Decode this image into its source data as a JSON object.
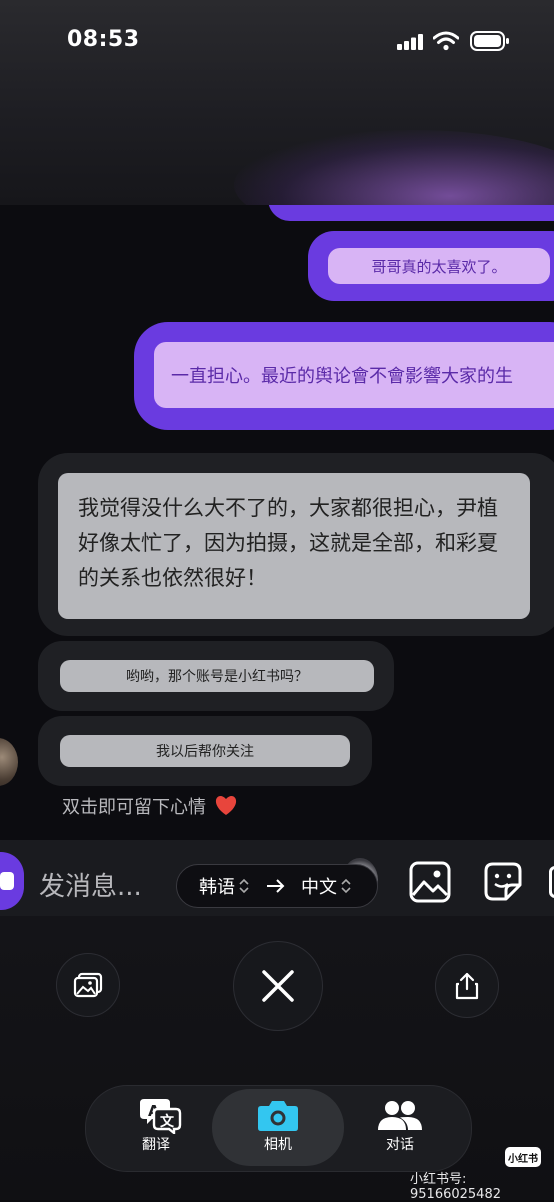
{
  "status_bar": {
    "time": "08:53"
  },
  "messages": {
    "sent_1": "哥哥真的太喜欢了。",
    "sent_2": "一直担心。最近的舆论會不會影響大家的生",
    "recv_1": "我觉得没什么大不了的，大家都很担心，尹植好像太忙了，因为拍摄，这就是全部，和彩夏的关系也依然很好！",
    "recv_2": "哟哟，那个账号是小红书吗？",
    "recv_3": "我以后帮你关注"
  },
  "hint": "双击即可留下心情",
  "input": {
    "placeholder": "发消息..."
  },
  "translator": {
    "source_lang": "韩语",
    "arrow": "→",
    "target_lang": "中文"
  },
  "tabs": [
    {
      "label": "翻译",
      "icon": "translate-icon"
    },
    {
      "label": "相机",
      "icon": "camera-icon",
      "selected": true
    },
    {
      "label": "对话",
      "icon": "people-icon"
    }
  ],
  "watermark": {
    "text": "小红书号: 95166025482",
    "logo": "小红书"
  },
  "colors": {
    "accent_purple": "#6a3be0",
    "bubble_purple": "#d8b4f5",
    "camera_tab": "#33c6f0",
    "heart": "#e8453c"
  }
}
